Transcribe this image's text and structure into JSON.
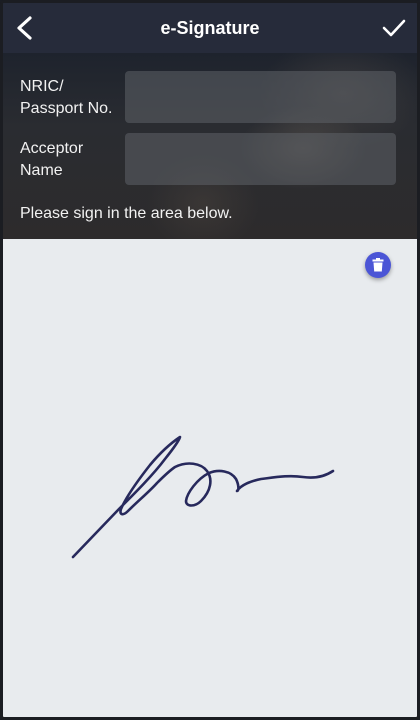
{
  "header": {
    "title": "e-Signature",
    "back_icon": "chevron-left-icon",
    "done_icon": "checkmark-icon"
  },
  "form": {
    "nric_label": "NRIC/\nPassport No.",
    "nric_value": "",
    "acceptor_label": "Acceptor\nName",
    "acceptor_value": "",
    "hint": "Please sign in the area below."
  },
  "signature_pad": {
    "clear_icon": "trash-icon",
    "accent_color": "#4b55d6",
    "stroke_color": "#27295c"
  }
}
